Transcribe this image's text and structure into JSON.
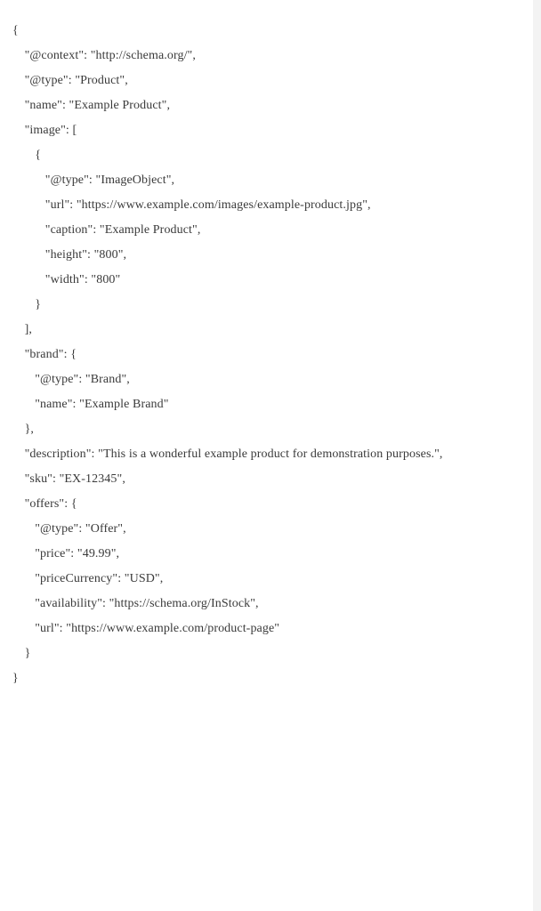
{
  "code": {
    "l0": "{",
    "l1": " \"@context\": \"http://schema.org/\",",
    "l2": " \"@type\": \"Product\",",
    "l3": " \"name\": \"Example Product\",",
    "l4": " \"image\": [",
    "l5": "  {",
    "l6": "   \"@type\": \"ImageObject\",",
    "l7": "   \"url\": \"https://www.example.com/images/example-product.jpg\",",
    "l8": "   \"caption\": \"Example Product\",",
    "l9": "   \"height\": \"800\",",
    "l10": "   \"width\": \"800\"",
    "l11": "  }",
    "l12": " ],",
    "l13": " \"brand\": {",
    "l14": "  \"@type\": \"Brand\",",
    "l15": "  \"name\": \"Example Brand\"",
    "l16": " },",
    "l17": " \"description\": \"This is a wonderful example product for demonstration purposes.\",",
    "l18": " \"sku\": \"EX-12345\",",
    "l19": " \"offers\": {",
    "l20": "  \"@type\": \"Offer\",",
    "l21": "  \"price\": \"49.99\",",
    "l22": "  \"priceCurrency\": \"USD\",",
    "l23": "  \"availability\": \"https://schema.org/InStock\",",
    "l24": "  \"url\": \"https://www.example.com/product-page\"",
    "l25": " }",
    "l26": "}"
  }
}
